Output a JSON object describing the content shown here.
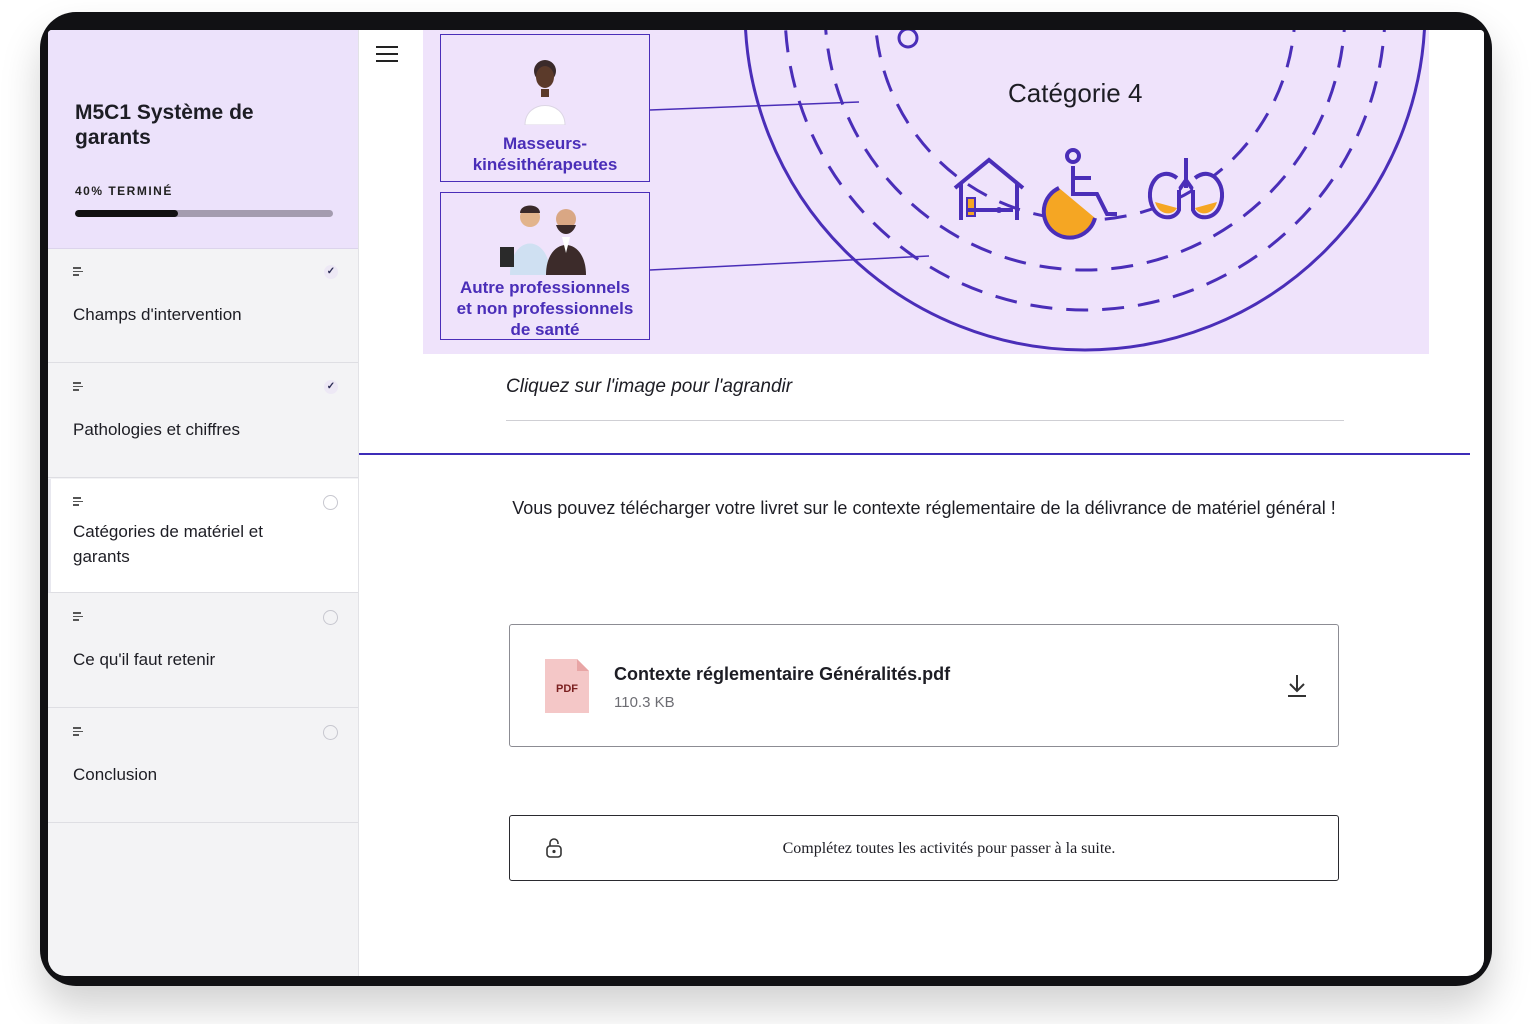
{
  "course": {
    "title": "M5C1 Système de garants",
    "progress_label": "40% TERMINÉ",
    "progress_fraction": 0.4
  },
  "lessons": [
    {
      "label": "Champs d'intervention",
      "status": "completed"
    },
    {
      "label": "Pathologies et chiffres",
      "status": "completed"
    },
    {
      "label": "Catégories de matériel et garants",
      "status": "current"
    },
    {
      "label": "Ce qu'il faut retenir",
      "status": "not-started"
    },
    {
      "label": "Conclusion",
      "status": "not-started"
    }
  ],
  "illustration": {
    "box1_line1": "Masseurs-",
    "box1_line2": "kinésithérapeutes",
    "box2_line1": "Autre professionnels",
    "box2_line2": "et non professionnels",
    "box2_line3": "de santé",
    "category_label": "Catégorie 4",
    "accent_color": "#4a2eb8",
    "highlight_color": "#f5a623",
    "icons": [
      "bed-icon",
      "wheelchair-icon",
      "lungs-icon"
    ]
  },
  "caption": "Cliquez sur l'image pour l'agrandir",
  "download_text": "Vous pouvez télécharger votre livret sur le contexte réglementaire de la délivrance de matériel général !",
  "file": {
    "type_label": "PDF",
    "name": "Contexte réglementaire Généralités.pdf",
    "size": "110.3 KB"
  },
  "lock_message": "Complétez toutes les activités pour passer à la suite."
}
